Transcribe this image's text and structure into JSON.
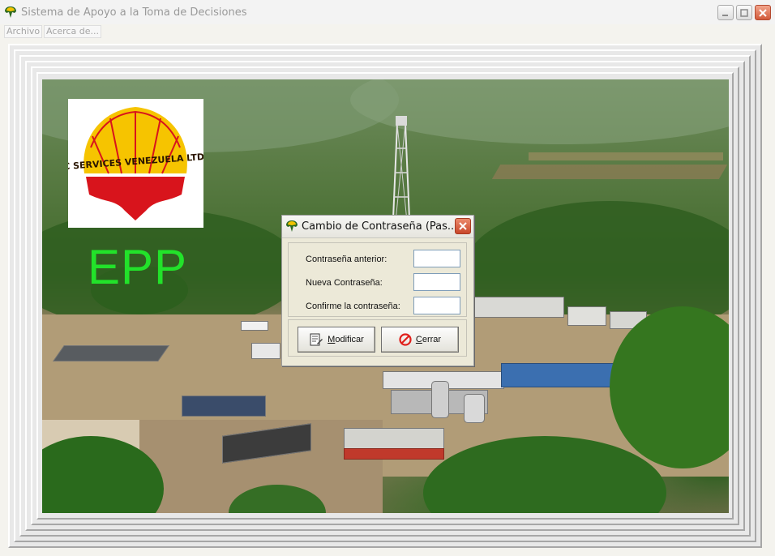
{
  "window": {
    "title": "Sistema de Apoyo a la Toma de Decisiones",
    "menu": [
      "Archivo",
      "Acerca de..."
    ]
  },
  "background": {
    "logo_text": "CHPC SERVICES VENEZUELA LTD, S.A",
    "app_label": "EPP"
  },
  "dialog": {
    "title": "Cambio de Contraseña (Pas...",
    "fields": [
      {
        "label": "Contraseña anterior:",
        "value": ""
      },
      {
        "label": "Nueva Contraseña:",
        "value": ""
      },
      {
        "label": "Confirme la contraseña:",
        "value": ""
      }
    ],
    "buttons": {
      "modify": "Modificar",
      "close": "Cerrar"
    }
  },
  "colors": {
    "epp_label": "#22e22a",
    "logo_yellow": "#f6c400",
    "logo_red": "#d8141c",
    "close_button": "#c8472a"
  },
  "icons": {
    "app": "shell-logo-icon",
    "modify": "edit-document-icon",
    "close": "cancel-circle-icon"
  }
}
